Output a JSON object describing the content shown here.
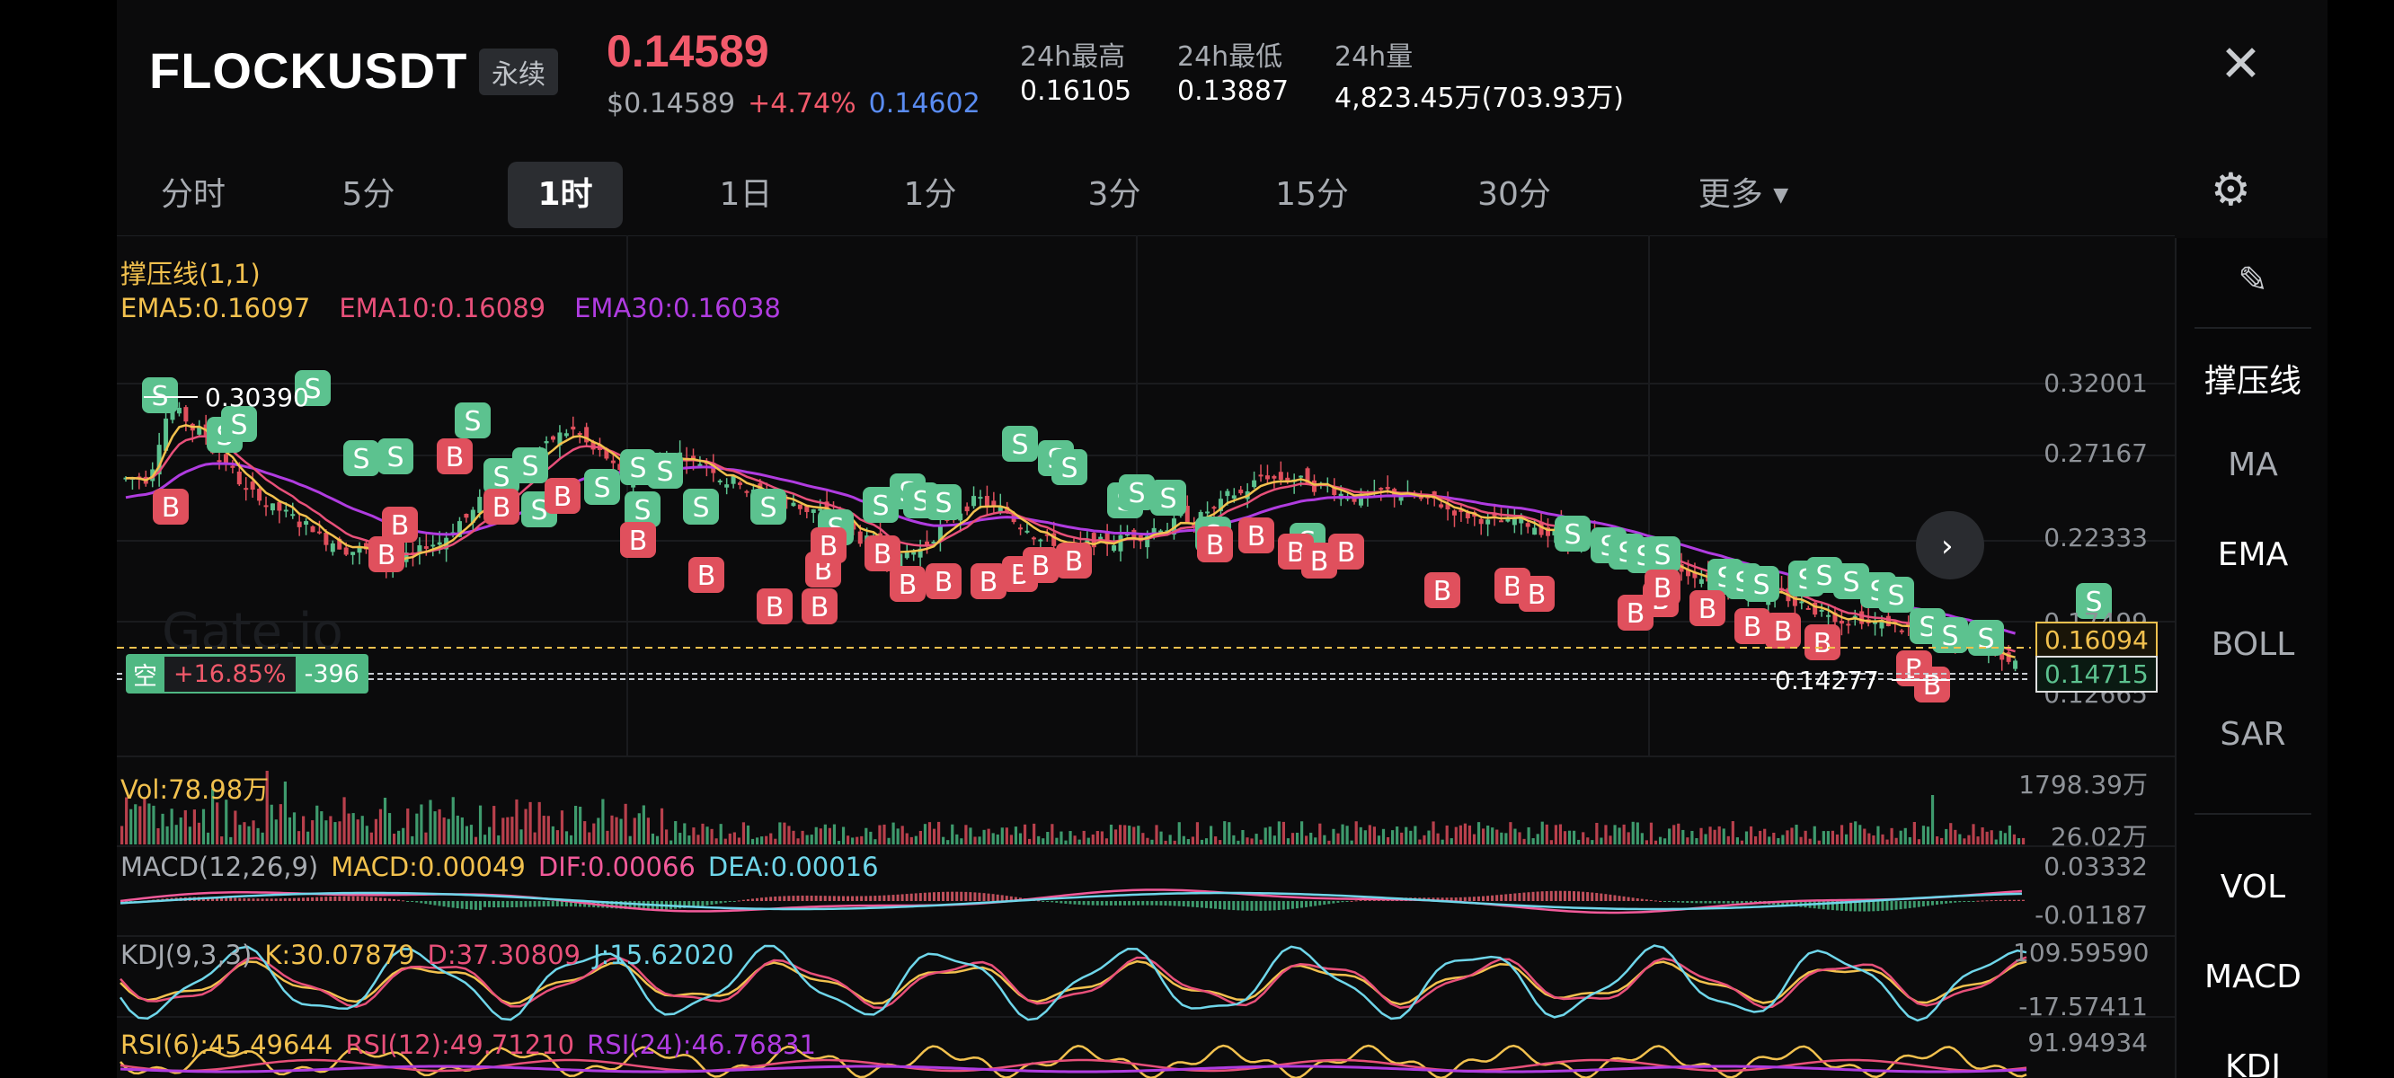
{
  "header": {
    "symbol": "FLOCKUSDT",
    "contract_type": "永续",
    "last_price": "0.14589",
    "usd_price": "$0.14589",
    "change_pct": "+4.74%",
    "mark_price": "0.14602",
    "high_label": "24h最高",
    "high_value": "0.16105",
    "low_label": "24h最低",
    "low_value": "0.13887",
    "vol_label": "24h量",
    "vol_value": "4,823.45万(703.93万)",
    "close_icon": "close-icon"
  },
  "tabs": [
    {
      "label": "分时",
      "active": false
    },
    {
      "label": "5分",
      "active": false
    },
    {
      "label": "1时",
      "active": true
    },
    {
      "label": "1日",
      "active": false
    },
    {
      "label": "1分",
      "active": false
    },
    {
      "label": "3分",
      "active": false
    },
    {
      "label": "15分",
      "active": false
    },
    {
      "label": "30分",
      "active": false
    },
    {
      "label": "更多",
      "active": false
    }
  ],
  "settings_icon": "gear-icon",
  "sidebar": {
    "edit_icon": "pencil-icon",
    "items": [
      "撑压线",
      "MA",
      "EMA",
      "BOLL",
      "SAR",
      "VOL",
      "MACD",
      "KDJ"
    ]
  },
  "main_chart": {
    "indicator_title": "撑压线(1,1)",
    "ema5": "EMA5:0.16097",
    "ema10": "EMA10:0.16089",
    "ema30": "EMA30:0.16038",
    "watermark": "Gate.io",
    "high_marker": "0.30390",
    "low_marker": "0.14277",
    "axis": [
      "0.32001",
      "0.27167",
      "0.22333",
      "0.17499",
      "0.12665"
    ],
    "support_price": "0.16094",
    "current_price": "0.14715",
    "position": {
      "side": "空",
      "pnl_pct": "+16.85%",
      "pnl": "-396"
    },
    "colors": {
      "up": "#5cc28f",
      "down": "#e0505d",
      "ema5": "#f2c14e",
      "ema10": "#e8507a",
      "ema30": "#b03ce0"
    }
  },
  "volume": {
    "label": "Vol:78.98万",
    "max": "1798.39万",
    "mid": "26.02万"
  },
  "macd": {
    "title": "MACD(12,26,9)",
    "macd": "MACD:0.00049",
    "dif": "DIF:0.00066",
    "dea": "DEA:0.00016",
    "max": "0.03332",
    "min": "-0.01187"
  },
  "kdj": {
    "title": "KDJ(9,3,3)",
    "k": "K:30.07879",
    "d": "D:37.30809",
    "j": "J:15.62020",
    "max": "109.59590",
    "min": "-17.57411"
  },
  "rsi": {
    "rsi6": "RSI(6):45.49644",
    "rsi12": "RSI(12):49.71210",
    "rsi24": "RSI(24):46.76831",
    "max": "91.94934"
  },
  "chart_data": {
    "type": "candlestick",
    "y_axis_ticks": [
      0.32001,
      0.27167,
      0.22333,
      0.17499,
      0.12665
    ],
    "ylim": [
      0.12665,
      0.32001
    ],
    "series_close": [
      0.26,
      0.304,
      0.29,
      0.27,
      0.25,
      0.24,
      0.23,
      0.22,
      0.215,
      0.205,
      0.21,
      0.22,
      0.235,
      0.25,
      0.268,
      0.28,
      0.29,
      0.276,
      0.26,
      0.27,
      0.275,
      0.27,
      0.258,
      0.25,
      0.245,
      0.24,
      0.235,
      0.22,
      0.21,
      0.215,
      0.23,
      0.245,
      0.24,
      0.23,
      0.22,
      0.215,
      0.22,
      0.225,
      0.23,
      0.235,
      0.24,
      0.25,
      0.262,
      0.26,
      0.255,
      0.25,
      0.248,
      0.25,
      0.245,
      0.24,
      0.235,
      0.232,
      0.23,
      0.225,
      0.22,
      0.215,
      0.21,
      0.205,
      0.2,
      0.198,
      0.19,
      0.185,
      0.18,
      0.176,
      0.172,
      0.168,
      0.165,
      0.16,
      0.155,
      0.15,
      0.147
    ],
    "buy_sell_markers": "B/S trade markers overlay"
  }
}
